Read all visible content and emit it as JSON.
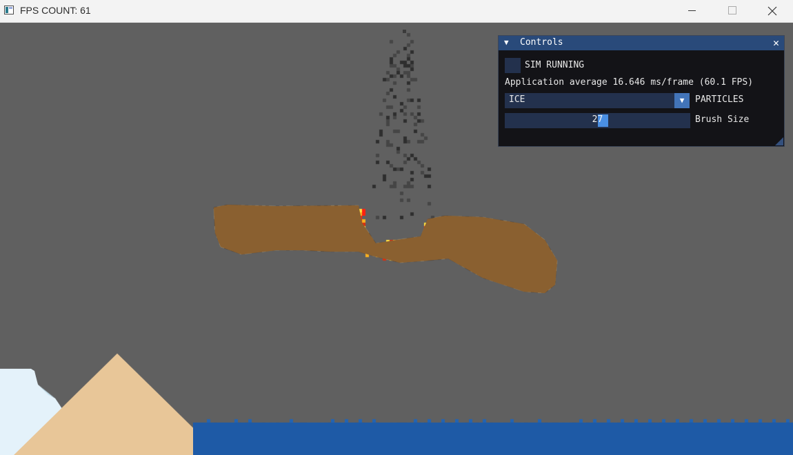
{
  "window": {
    "title": "FPS COUNT: 61",
    "icon": "app-window-icon",
    "controls": [
      "minimize-icon",
      "maximize-icon",
      "close-icon"
    ]
  },
  "scene": {
    "background_color": "#606060",
    "elements": [
      "ice",
      "sand",
      "water",
      "wood",
      "fire",
      "smoke"
    ],
    "colors": {
      "water": "#1e5aa6",
      "sand": "#e8c698",
      "ice": "#e4f2fa",
      "wood": "#8a6030",
      "fire": "#f8b020",
      "smoke": "#3a3a3a"
    }
  },
  "controls_panel": {
    "title": "Controls",
    "collapse_icon": "triangle-down-icon",
    "close_icon": "close-icon",
    "sim_running": {
      "label": "SIM RUNNING",
      "checked": false
    },
    "performance_text": "Application average 16.646 ms/frame (60.1 FPS)",
    "particles": {
      "selected": "ICE",
      "label": "PARTICLES",
      "arrow_icon": "triangle-down-icon"
    },
    "brush_size": {
      "value": "27",
      "label": "Brush Size"
    },
    "header_color": "#294a7a",
    "frame_color": "#23314d",
    "accent_color": "#4a8fe3"
  }
}
